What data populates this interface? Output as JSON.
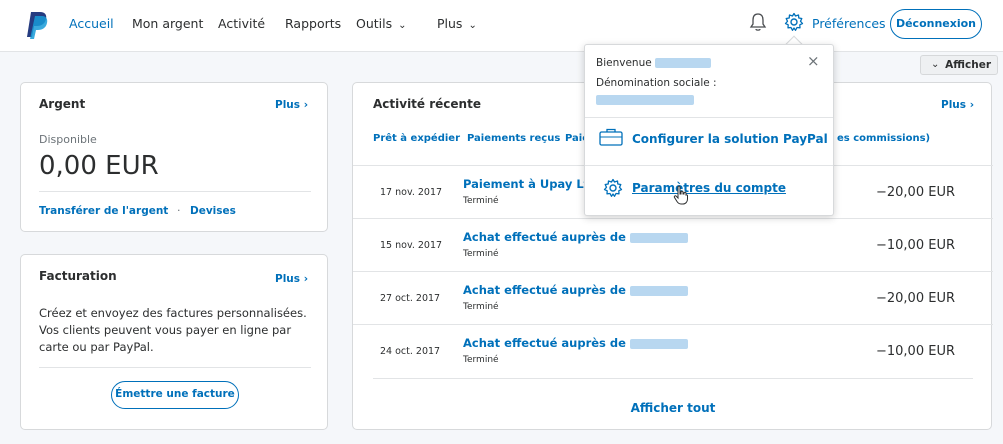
{
  "nav": {
    "home": "Accueil",
    "money": "Mon argent",
    "activity": "Activité",
    "reports": "Rapports",
    "tools": "Outils",
    "more": "Plus",
    "preferences": "Préférences",
    "logout": "Déconnexion"
  },
  "show_button": "Afficher",
  "money_card": {
    "title": "Argent",
    "more": "Plus",
    "available_label": "Disponible",
    "balance": "0,00 EUR",
    "transfer": "Transférer de l'argent",
    "separator": "·",
    "currencies": "Devises"
  },
  "billing_card": {
    "title": "Facturation",
    "more": "Plus",
    "description": "Créez et envoyez des factures personnalisées. Vos clients peuvent vous payer en ligne par carte ou par PayPal.",
    "button": "Émettre une facture"
  },
  "activity_card": {
    "title": "Activité récente",
    "more": "Plus",
    "filters": [
      "Prêt à expédier",
      "Paiements reçus",
      "Paie",
      "es commissions)"
    ],
    "see_all": "Afficher tout",
    "transactions": [
      {
        "date": "17 nov. 2017",
        "title": "Paiement à Upay Ltd",
        "status": "Terminé",
        "amount": "−20,00 EUR"
      },
      {
        "date": "15 nov. 2017",
        "title": "Achat effectué auprès de",
        "status": "Terminé",
        "amount": "−10,00 EUR"
      },
      {
        "date": "27 oct. 2017",
        "title": "Achat effectué auprès de",
        "status": "Terminé",
        "amount": "−20,00 EUR"
      },
      {
        "date": "24 oct. 2017",
        "title": "Achat effectué auprès de",
        "status": "Terminé",
        "amount": "−10,00 EUR"
      }
    ]
  },
  "dropdown": {
    "welcome": "Bienvenue",
    "company_label": "Dénomination sociale :",
    "close": "×",
    "setup": "Configurer la solution PayPal",
    "settings": "Paramètres du compte"
  },
  "colors": {
    "accent": "#0070ba",
    "logo_dark": "#253b80",
    "logo_light": "#179bd7"
  },
  "icons": [
    "paypal-logo",
    "bell-icon",
    "gear-icon",
    "chevron-down-icon",
    "chevron-right-icon",
    "close-icon",
    "briefcase-icon",
    "hand-cursor-icon"
  ]
}
